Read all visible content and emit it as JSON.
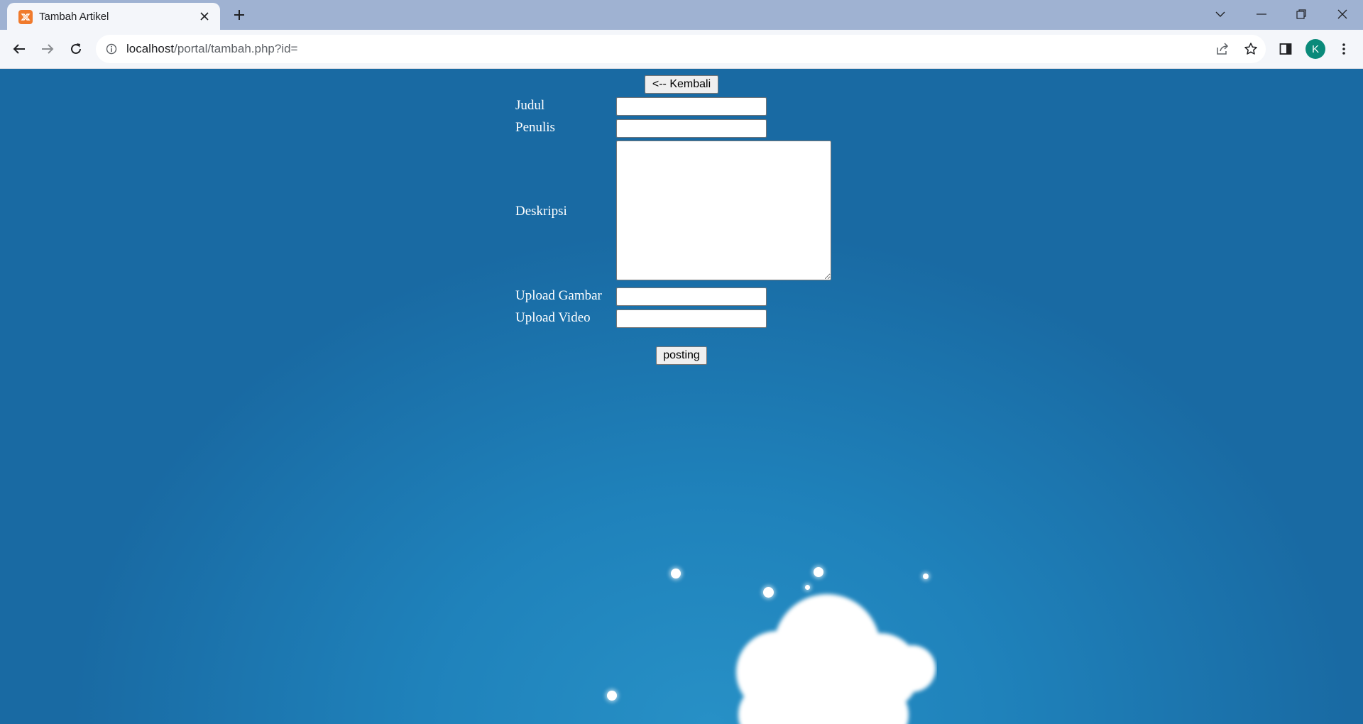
{
  "browser": {
    "tab": {
      "title": "Tambah Artikel",
      "favicon": "xampp-icon"
    },
    "address": {
      "host": "localhost",
      "path": "/portal/tambah.php?id="
    },
    "profile_initial": "K"
  },
  "form": {
    "back_button": "<-- Kembali",
    "fields": {
      "judul": {
        "label": "Judul",
        "value": ""
      },
      "penulis": {
        "label": "Penulis",
        "value": ""
      },
      "deskripsi": {
        "label": "Deskripsi",
        "value": ""
      },
      "upload_gambar": {
        "label": "Upload Gambar",
        "value": ""
      },
      "upload_video": {
        "label": "Upload Video",
        "value": ""
      }
    },
    "submit_button": "posting"
  },
  "colors": {
    "page_background": "#1f82bb",
    "tabbar": "#9fb2d2",
    "toolbar": "#f4f6fa",
    "avatar": "#0a8a7a",
    "favicon": "#f07a2c"
  }
}
